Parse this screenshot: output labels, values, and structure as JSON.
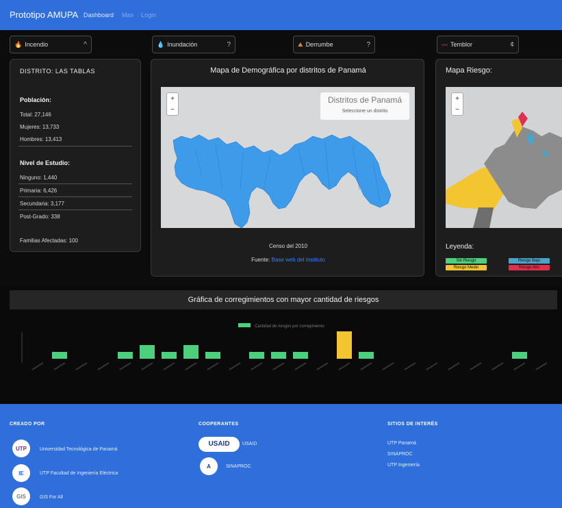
{
  "navbar": {
    "brand": "Prototipo AMUPA",
    "links": [
      "Dashboard",
      "Mas",
      "Login"
    ]
  },
  "hazards": [
    {
      "icon": "fire-icon",
      "label": "Incendio",
      "glyph": "🔥",
      "chevron": "^"
    },
    {
      "icon": "water-drop-icon",
      "label": "Inundación",
      "glyph": "💧",
      "chevron": "?"
    },
    {
      "icon": "landslide-icon",
      "label": "Derrumbe",
      "glyph": "⛰",
      "chevron": "?"
    },
    {
      "icon": "earthquake-icon",
      "label": "Temblor",
      "glyph": "〰",
      "chevron": "¢"
    }
  ],
  "district": {
    "title": "DISTRITO: LAS TABLAS",
    "population_heading": "Población:",
    "population": [
      "Total: 27,146",
      "Mujeres: 13,733",
      "Hombres: 13,413"
    ],
    "education_heading": "Nivel de Estudio:",
    "education": [
      "Ninguno: 1,440",
      "Primaria: 6,426",
      "Secundaria: 3,177",
      "Post-Grado: 338"
    ],
    "families": "Familias Afectadas: 100"
  },
  "map": {
    "title": "Mapa de Demográfica por distritos de Panamá",
    "zoom_in": "+",
    "zoom_out": "−",
    "info_title": "Distritos de Panamá",
    "info_sub": "Seleccione un distrito",
    "census": "Censo del 2010",
    "source_label": "Fuente:",
    "source_link": "Base web del Instituto"
  },
  "risk_map": {
    "title": "Mapa Riesgo:",
    "zoom_in": "+",
    "zoom_out": "−",
    "legend_title": "Leyenda:",
    "legend": [
      {
        "label": "Sin Riesgo",
        "color": "#4cd07d"
      },
      {
        "label": "Riesgo Bajo",
        "color": "#4aa3c9"
      },
      {
        "label": "Riesgo Medio",
        "color": "#f2c531"
      },
      {
        "label": "Riesgo Alto",
        "color": "#e0304e"
      }
    ]
  },
  "chart": {
    "title_bar": "Gráfica de corregimientos con mayor cantidad de riesgos"
  },
  "chart_data": {
    "type": "bar",
    "legend": "Cantidad de riesgos por corregimiento",
    "values": [
      0,
      1,
      0,
      0,
      1,
      2,
      1,
      2,
      1,
      0,
      1,
      1,
      1,
      0,
      4,
      1,
      0,
      0,
      0,
      0,
      0,
      0,
      1,
      0
    ],
    "colors": [
      "#4cd07d",
      "#4cd07d",
      "#4cd07d",
      "#4cd07d",
      "#4cd07d",
      "#4cd07d",
      "#4cd07d",
      "#4cd07d",
      "#4cd07d",
      "#4cd07d",
      "#4cd07d",
      "#4cd07d",
      "#4cd07d",
      "#4cd07d",
      "#f2c531",
      "#4cd07d",
      "#4cd07d",
      "#4cd07d",
      "#4cd07d",
      "#4cd07d",
      "#4cd07d",
      "#4cd07d",
      "#4cd07d",
      "#4cd07d"
    ],
    "ylim": [
      0,
      4
    ]
  },
  "footer": {
    "col1_heading": "CREADO POR",
    "creators": [
      {
        "logo": "UTP",
        "text": "Universidad Tecnológica de Panamá"
      },
      {
        "logo": "IE",
        "text": "UTP Facultad de Ingeniería Eléctrica"
      },
      {
        "logo": "GIS",
        "text": "GIS For All"
      }
    ],
    "col2_heading": "COOPERANTES",
    "partners": [
      {
        "logo": "USAID",
        "text": "USAID"
      },
      {
        "logo": "A",
        "text": "SINAPROC"
      }
    ],
    "col3_heading": "SITIOS DE INTERÉS",
    "links": [
      "UTP Panamá",
      "SINAPROC",
      "UTP Ingeniería"
    ]
  },
  "colors": {
    "navbar": "#2f6fdc",
    "map_fill": "#3d9be9",
    "background": "#0c0c0c"
  }
}
